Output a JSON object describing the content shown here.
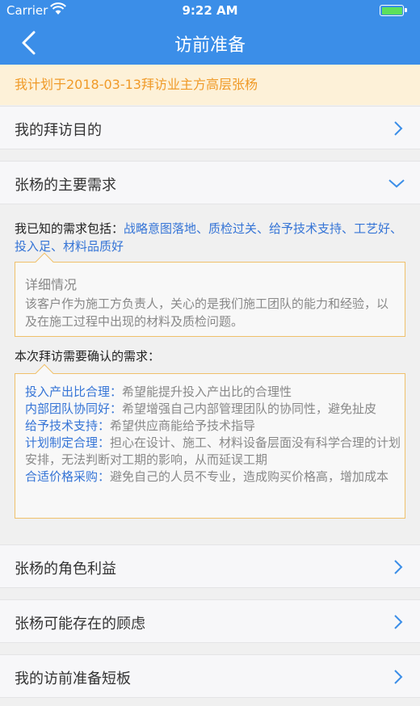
{
  "status_bar": {
    "carrier": "Carrier",
    "time": "9:22 AM"
  },
  "nav": {
    "title": "访前准备"
  },
  "banner": {
    "text": "我计划于2018-03-13拜访业主方高层张杨"
  },
  "rows": {
    "purpose": "我的拜访目的",
    "needs": "张杨的主要需求",
    "role": "张杨的角色利益",
    "concerns": "张杨可能存在的顾虑",
    "weakness": "我的访前准备短板"
  },
  "needs_panel": {
    "known_prefix": "我已知的需求包括：",
    "known_tags": "战略意图落地、质检过关、给予技术支持、工艺好、投入足、材料品质好",
    "detail_title": "详细情况",
    "detail_text": "该客户作为施工方负责人，关心的是我们施工团队的能力和经验，以及在施工过程中出现的材料及质检问题。",
    "confirm_label": "本次拜访需要确认的需求：",
    "confirm_items": [
      {
        "key": "投入产出比合理：",
        "desc": "希望能提升投入产出比的合理性"
      },
      {
        "key": "内部团队协同好：",
        "desc": "希望增强自己内部管理团队的协同性，避免扯皮"
      },
      {
        "key": "给予技术支持：",
        "desc": "希望供应商能给予技术指导"
      },
      {
        "key": "计划制定合理：",
        "desc": "担心在设计、施工、材料设备层面没有科学合理的计划安排，无法判断对工期的影响，从而延误工期"
      },
      {
        "key": "合适价格采购：",
        "desc": "避免自己的人员不专业，造成购买价格高，增加成本"
      }
    ]
  },
  "colors": {
    "nav_bg": "#3b8ee8",
    "banner_bg": "#fdf1d8",
    "banner_text": "#f09a28",
    "accent_blue": "#3574d6",
    "box_border": "#f0c06a"
  }
}
